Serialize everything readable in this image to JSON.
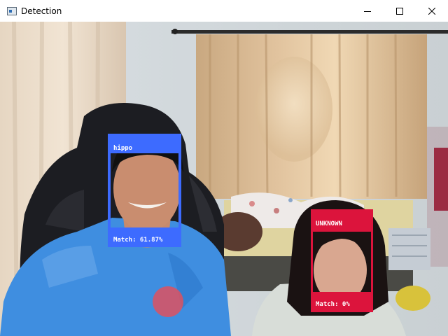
{
  "window": {
    "title": "Detection",
    "icon": "app-window-icon",
    "controls": [
      "minimize-icon",
      "maximize-icon",
      "close-icon"
    ]
  },
  "detections": [
    {
      "name": "hippo",
      "match": "Match: 61.87%",
      "color": "#3d6bff"
    },
    {
      "name": "UNKNOWN",
      "match": "Match: 0%",
      "color": "#dc143c"
    }
  ]
}
